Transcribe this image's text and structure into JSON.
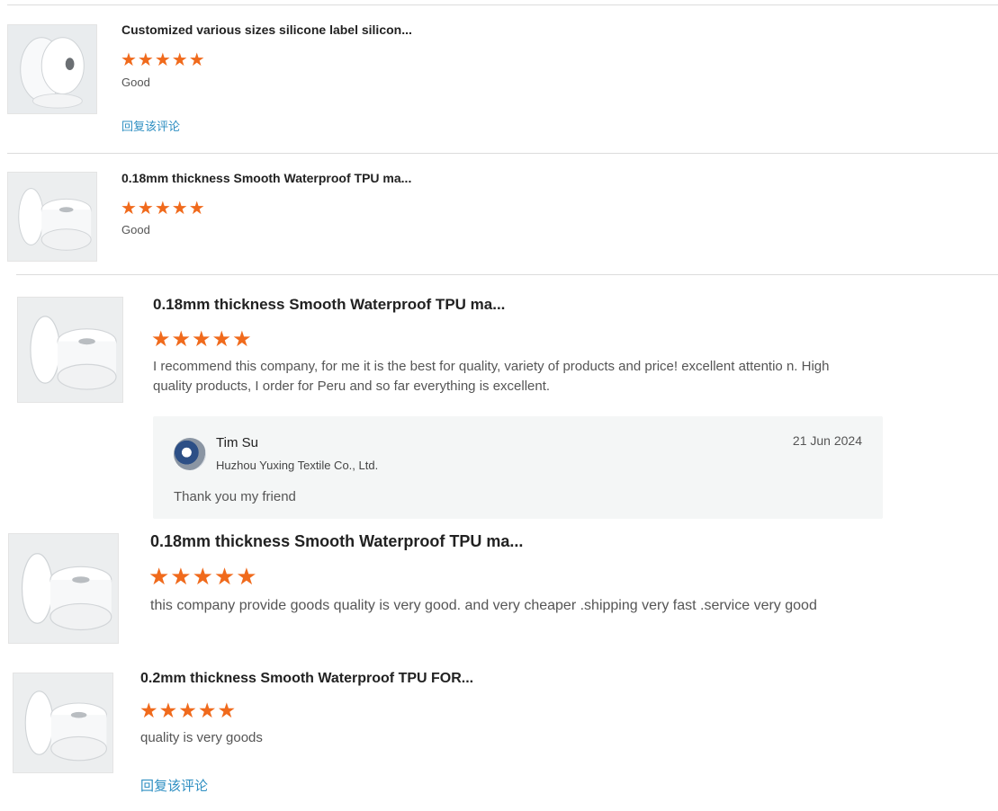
{
  "reviews": [
    {
      "title": "Customized various sizes silicone label silicon...",
      "stars": "★★★★★",
      "text": "Good",
      "reply_link": "回复该评论"
    },
    {
      "title": "0.18mm thickness Smooth Waterproof TPU ma...",
      "stars": "★★★★★",
      "text": "Good"
    },
    {
      "title": "0.18mm thickness Smooth Waterproof TPU ma...",
      "stars": "★★★★★",
      "text": "I recommend this company, for me it is the best for quality, variety of products and price! excellent attentio n. High quality products, I order for Peru and so far everything is excellent.",
      "reply": {
        "name": "Tim Su",
        "company": "Huzhou Yuxing Textile Co., Ltd.",
        "date": "21 Jun 2024",
        "message": "Thank you my friend"
      }
    },
    {
      "title": "0.18mm thickness Smooth Waterproof TPU ma...",
      "stars": "★★★★★",
      "text": "this company provide goods quality is very good. and very cheaper .shipping very fast .service very good"
    },
    {
      "title": "0.2mm thickness Smooth Waterproof TPU FOR...",
      "stars": "★★★★★",
      "text": "quality is very goods",
      "reply_link": "回复该评论"
    }
  ],
  "colors": {
    "star": "#f06a1c",
    "link": "#2f8fc2",
    "reply_bg": "#f4f6f6"
  },
  "rating": 5,
  "rating_max": 5
}
